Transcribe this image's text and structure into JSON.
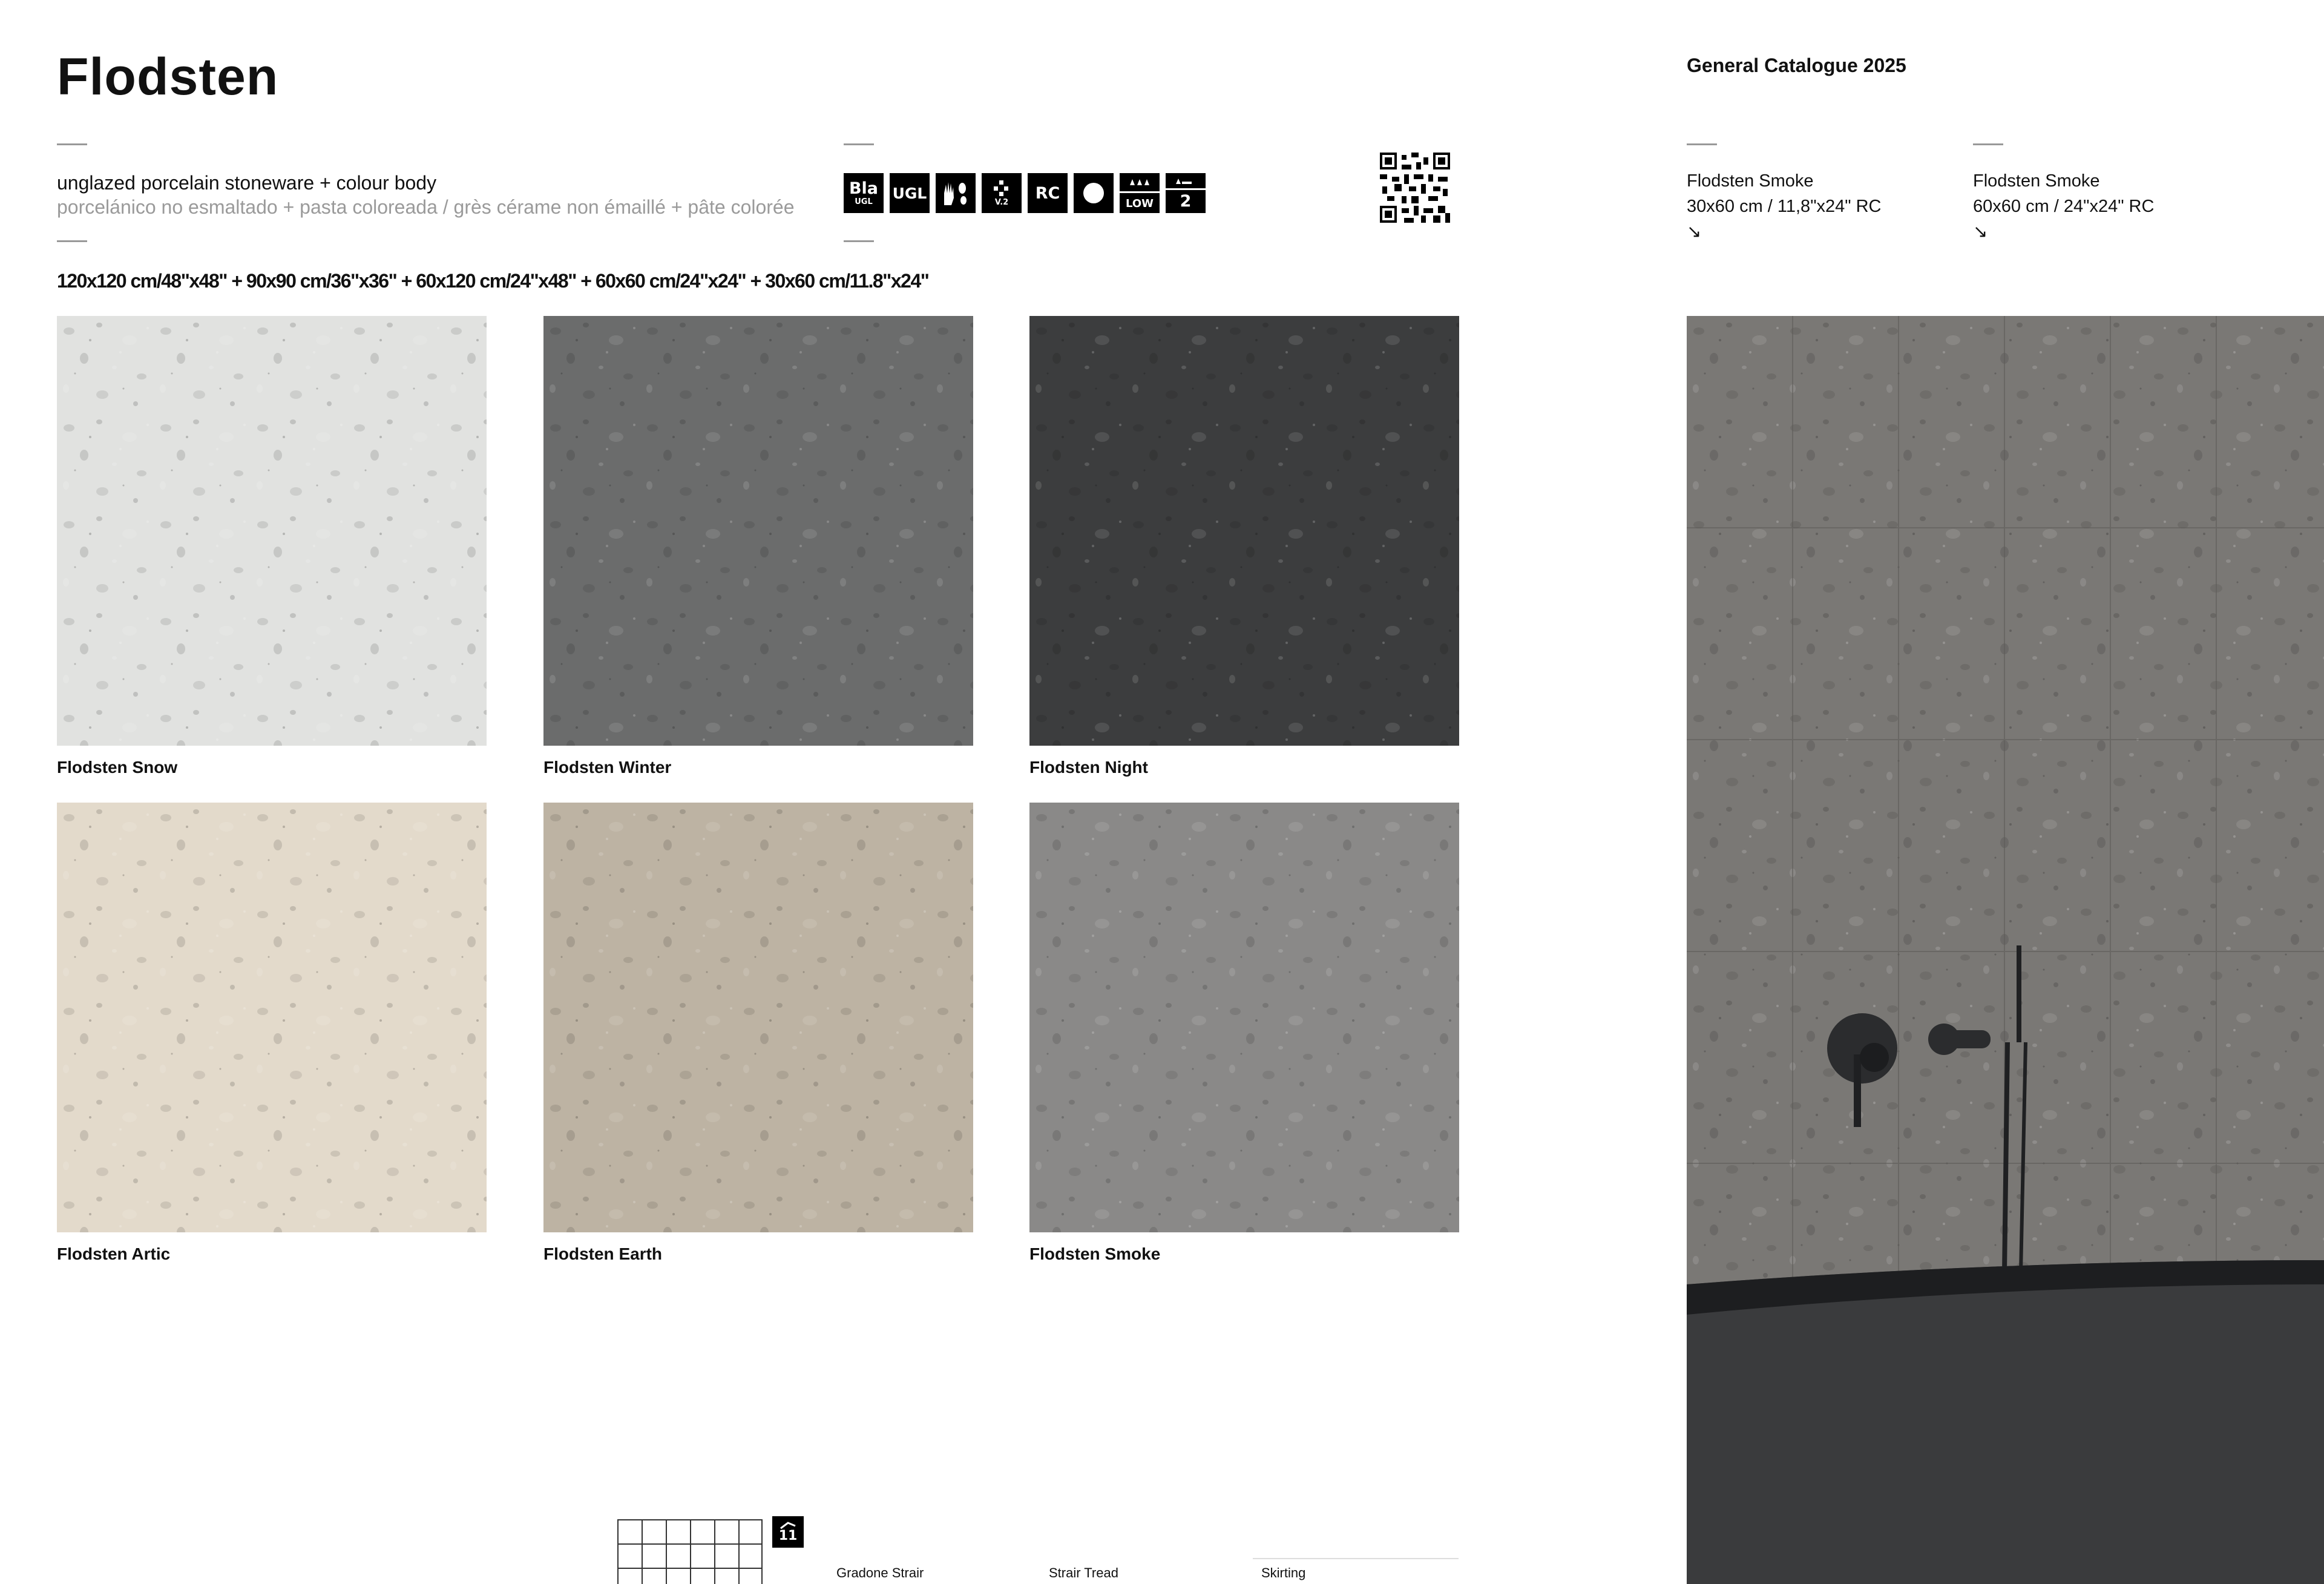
{
  "header": {
    "title": "Flodsten",
    "catalogue": "General Catalogue 2025"
  },
  "description": {
    "line_en": "unglazed porcelain stoneware + colour body",
    "line_es_fr": "porcelánico no esmaltado + pasta coloreada / grès cérame non émaillé + pâte colorée"
  },
  "formats": "120x120 cm/48\"x48\" + 90x90 cm/36\"x36\" + 60x120 cm/24\"x48\" + 60x60 cm/24\"x24\" + 30x60 cm/11.8\"x24\"",
  "icons": [
    {
      "name": "bla-ugl-icon",
      "big": "Bla",
      "small": "UGL"
    },
    {
      "name": "ugl-icon",
      "big": "UGL",
      "small": ""
    },
    {
      "name": "hand-foot-icon",
      "big": "✋👣",
      "small": ""
    },
    {
      "name": "v2-shade-icon",
      "big": "▪▪",
      "small": "V.2"
    },
    {
      "name": "rc-icon",
      "big": "RC",
      "small": ""
    },
    {
      "name": "circle-icon",
      "big": "●",
      "small": ""
    },
    {
      "name": "low-traffic-icon",
      "big": "▲▲▲",
      "small": "LOW"
    },
    {
      "name": "level-2-icon",
      "big": "2",
      "small": ""
    }
  ],
  "tiles": [
    {
      "label": "Flodsten Snow",
      "color": "#e1e2e0"
    },
    {
      "label": "Flodsten Winter",
      "color": "#6b6c6c"
    },
    {
      "label": "Flodsten Night",
      "color": "#3c3d3e"
    },
    {
      "label": "Flodsten Artic",
      "color": "#e3dacb"
    },
    {
      "label": "Flodsten Earth",
      "color": "#bdb3a3"
    },
    {
      "label": "Flodsten Smoke",
      "color": "#8a8988"
    }
  ],
  "specs": [
    {
      "name": "Flodsten Smoke",
      "size": "30x60 cm / 11,8\"x24\" RC",
      "arrow": "↘"
    },
    {
      "name": "Flodsten Smoke",
      "size": "60x60 cm / 24\"x24\" RC",
      "arrow": "↘"
    }
  ],
  "footer": {
    "badge_number": "11",
    "labels": [
      "Gradone Strair",
      "Strair Tread",
      "Skirting"
    ]
  },
  "colors": {
    "photo_wall": "#7a7875",
    "photo_tub": "#3a3b3d"
  }
}
